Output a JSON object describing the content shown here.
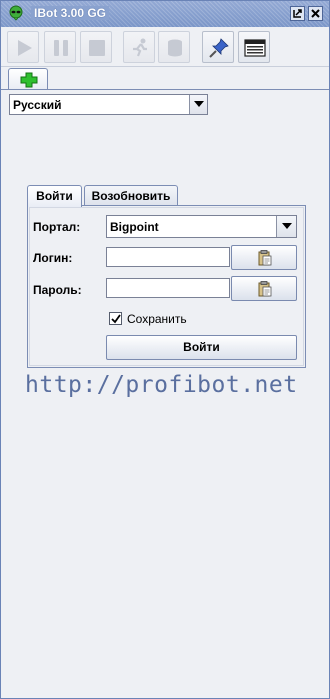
{
  "window": {
    "title": "IBot 3.00 GG",
    "restore_icon": "restore-icon",
    "close_icon": "close-icon"
  },
  "toolbar": {
    "buttons": [
      {
        "icon": "play-icon",
        "enabled": false
      },
      {
        "icon": "pause-icon",
        "enabled": false
      },
      {
        "icon": "stop-icon",
        "enabled": false
      },
      {
        "icon": "run-icon",
        "enabled": false
      },
      {
        "icon": "database-icon",
        "enabled": false
      },
      {
        "icon": "pin-icon",
        "enabled": true
      },
      {
        "icon": "console-window-icon",
        "enabled": true
      }
    ]
  },
  "tabs": [
    {
      "icon": "add-plus-icon",
      "color": "#2fbf2f"
    }
  ],
  "language": {
    "selected": "Русский"
  },
  "login": {
    "tabs": [
      {
        "label": "Войти",
        "active": true
      },
      {
        "label": "Возобновить",
        "active": false
      }
    ],
    "portal_label": "Портал:",
    "portal_value": "Bigpoint",
    "login_label": "Логин:",
    "login_value": "",
    "password_label": "Пароль:",
    "password_value": "",
    "paste_icon": "clipboard-paste-icon",
    "remember_label": "Сохранить",
    "remember_checked": true,
    "submit_label": "Войти"
  },
  "watermark": "http://profibot.net",
  "colors": {
    "titlebar": "#7b96c8",
    "border": "#7c8db4",
    "watermark": "#5a6f9f"
  }
}
